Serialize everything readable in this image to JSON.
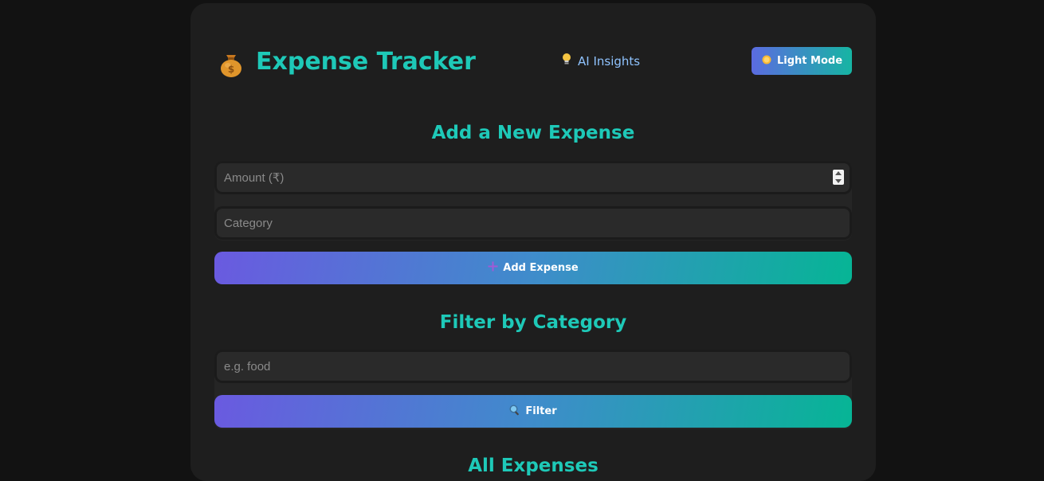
{
  "header": {
    "logo_icon": "money-bag-icon",
    "title": "Expense Tracker",
    "ai_link": {
      "icon": "lightbulb-icon",
      "label": "AI Insights"
    },
    "theme_toggle": {
      "icon": "sun-icon",
      "label": "Light Mode"
    }
  },
  "add_expense": {
    "heading": "Add a New Expense",
    "amount_placeholder": "Amount (₹)",
    "category_placeholder": "Category",
    "submit": {
      "icon": "plus-icon",
      "label": "Add Expense"
    }
  },
  "filter": {
    "heading": "Filter by Category",
    "input_placeholder": "e.g. food",
    "submit": {
      "icon": "magnifier-icon",
      "label": "Filter"
    }
  },
  "list": {
    "heading": "All Expenses"
  },
  "colors": {
    "page_bg": "#121212",
    "card_bg": "#1e1e1e",
    "accent": "#1ec9b8",
    "link": "#8fc3ff",
    "gradient_start": "#6a5ae0",
    "gradient_end": "#06b595"
  }
}
